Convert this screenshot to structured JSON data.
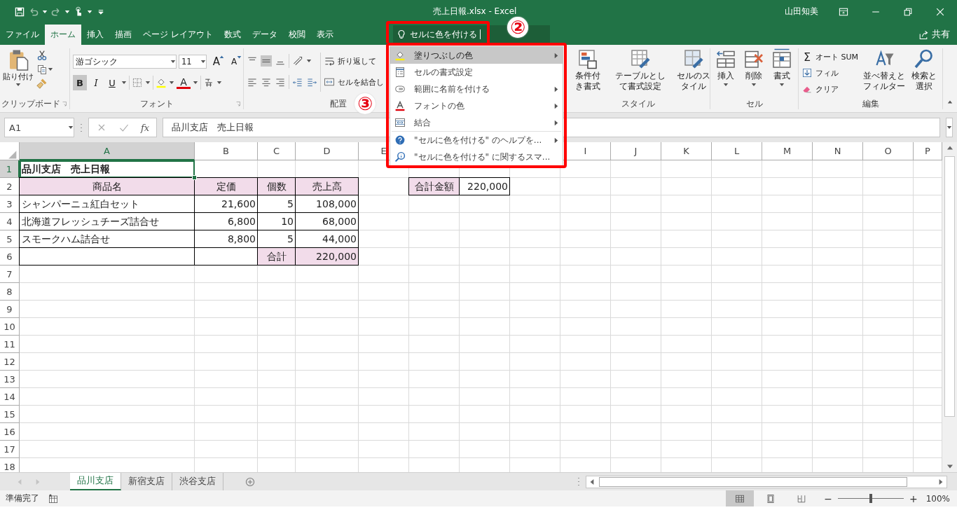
{
  "title_bar": {
    "title": "売上日報.xlsx - Excel",
    "user": "山田知美"
  },
  "tabs": [
    {
      "label": "ファイル",
      "selected": false
    },
    {
      "label": "ホーム",
      "selected": true
    },
    {
      "label": "挿入",
      "selected": false
    },
    {
      "label": "描画",
      "selected": false
    },
    {
      "label": "ページ レイアウト",
      "selected": false
    },
    {
      "label": "数式",
      "selected": false
    },
    {
      "label": "データ",
      "selected": false
    },
    {
      "label": "校閲",
      "selected": false
    },
    {
      "label": "表示",
      "selected": false
    }
  ],
  "search": {
    "value": "セルに色を付ける"
  },
  "share": "共有",
  "ribbon": {
    "clipboard": {
      "paste": "貼り付け",
      "label": "クリップボード"
    },
    "font": {
      "name": "游ゴシック",
      "size": "11",
      "grow": "A",
      "shrink": "A",
      "bold": "B",
      "italic": "I",
      "underline": "U",
      "color_letter": "A",
      "label": "フォント"
    },
    "alignment": {
      "wrap": "折り返して",
      "merge": "セルを結合し",
      "label": "配置"
    },
    "styles": {
      "buttons": [
        "条件付き書式",
        "テーブルとして書式設定",
        "セルのスタイル"
      ],
      "label": "スタイル"
    },
    "cells": {
      "buttons": [
        "挿入",
        "削除",
        "書式"
      ],
      "label": "セル"
    },
    "editing": {
      "sigma": "Σ",
      "autosum": "オート SUM",
      "fill": "フィル",
      "clear": "クリア",
      "sort": "並べ替えとフィルター",
      "find": "検索と選択",
      "label": "編集"
    }
  },
  "menu": [
    {
      "label": "塗りつぶしの色",
      "kind": "command",
      "submenu": true,
      "selected": true
    },
    {
      "label": "セルの書式設定",
      "kind": "command",
      "submenu": false,
      "selected": false
    },
    {
      "label": "範囲に名前を付ける",
      "kind": "command",
      "submenu": true,
      "selected": false
    },
    {
      "label": "フォントの色",
      "kind": "command",
      "submenu": true,
      "selected": false
    },
    {
      "label": "結合",
      "kind": "command",
      "submenu": true,
      "selected": false
    },
    {
      "label": "\"セルに色を付ける\" のヘルプを...",
      "kind": "help",
      "submenu": true,
      "selected": false
    },
    {
      "label": "\"セルに色を付ける\" に関するスマ...",
      "kind": "help",
      "submenu": false,
      "selected": false
    }
  ],
  "formula_bar": {
    "name_box": "A1",
    "function_label": "fx",
    "content": "品川支店　売上日報"
  },
  "sheet": {
    "columns": [
      {
        "label": "A",
        "selected": true
      },
      {
        "label": "B",
        "selected": false
      },
      {
        "label": "C",
        "selected": false
      },
      {
        "label": "D",
        "selected": false
      },
      {
        "label": "E",
        "selected": false
      },
      {},
      {},
      {},
      {
        "label": "I",
        "selected": false
      },
      {
        "label": "J",
        "selected": false
      },
      {
        "label": "K",
        "selected": false
      },
      {
        "label": "L",
        "selected": false
      },
      {
        "label": "M",
        "selected": false
      },
      {
        "label": "N",
        "selected": false
      },
      {
        "label": "O",
        "selected": false
      },
      {
        "label": "P",
        "selected": false
      }
    ],
    "rows": [
      {
        "num": "1",
        "selected": true,
        "cells": [
          {
            "text": "品川支店　売上日報",
            "kind": "title",
            "fill": false,
            "border": false
          }
        ]
      },
      {
        "num": "2",
        "selected": false,
        "cells": [
          {
            "text": "商品名",
            "kind": "heading",
            "fill": true,
            "border": true
          },
          {
            "text": "定価",
            "kind": "heading",
            "fill": true,
            "border": true
          },
          {
            "text": "個数",
            "kind": "heading",
            "fill": true,
            "border": true
          },
          {
            "text": "売上高",
            "kind": "heading",
            "fill": true,
            "border": true
          },
          {
            "fill": false,
            "border": false
          },
          {
            "text": "合計金額",
            "kind": "heading",
            "fill": true,
            "border": true
          },
          {
            "text": "220,000",
            "kind": "number",
            "fill": false,
            "border": true
          }
        ]
      },
      {
        "num": "3",
        "selected": false,
        "cells": [
          {
            "text": "シャンパーニュ紅白セット",
            "kind": "text",
            "fill": false,
            "border": true
          },
          {
            "text": "21,600",
            "kind": "number",
            "fill": false,
            "border": true
          },
          {
            "text": "5",
            "kind": "number",
            "fill": false,
            "border": true
          },
          {
            "text": "108,000",
            "kind": "number",
            "fill": false,
            "border": true
          }
        ]
      },
      {
        "num": "4",
        "selected": false,
        "cells": [
          {
            "text": "北海道フレッシュチーズ詰合せ",
            "kind": "text",
            "fill": false,
            "border": true
          },
          {
            "text": "6,800",
            "kind": "number",
            "fill": false,
            "border": true
          },
          {
            "text": "10",
            "kind": "number",
            "fill": false,
            "border": true
          },
          {
            "text": "68,000",
            "kind": "number",
            "fill": false,
            "border": true
          }
        ]
      },
      {
        "num": "5",
        "selected": false,
        "cells": [
          {
            "text": "スモークハム詰合せ",
            "kind": "text",
            "fill": false,
            "border": true
          },
          {
            "text": "8,800",
            "kind": "number",
            "fill": false,
            "border": true
          },
          {
            "text": "5",
            "kind": "number",
            "fill": false,
            "border": true
          },
          {
            "text": "44,000",
            "kind": "number",
            "fill": false,
            "border": true
          }
        ]
      },
      {
        "num": "6",
        "selected": false,
        "cells": [
          {
            "fill": false,
            "border": true
          },
          {
            "fill": false,
            "border": true
          },
          {
            "text": "合計",
            "kind": "heading",
            "fill": true,
            "border": true
          },
          {
            "text": "220,000",
            "kind": "number",
            "fill": true,
            "border": true
          }
        ]
      },
      {
        "num": "7",
        "selected": false
      },
      {
        "num": "8",
        "selected": false
      },
      {
        "num": "9",
        "selected": false
      },
      {
        "num": "10",
        "selected": false
      },
      {
        "num": "11",
        "selected": false
      },
      {
        "num": "12",
        "selected": false
      },
      {
        "num": "13",
        "selected": false
      },
      {
        "num": "14",
        "selected": false
      },
      {
        "num": "15",
        "selected": false
      },
      {
        "num": "16",
        "selected": false
      },
      {
        "num": "17",
        "selected": false
      },
      {
        "num": "18",
        "selected": false
      }
    ]
  },
  "sheet_tabs": [
    {
      "label": "品川支店",
      "selected": true
    },
    {
      "label": "新宿支店",
      "selected": false
    },
    {
      "label": "渋谷支店",
      "selected": false
    }
  ],
  "status_bar": {
    "text": "準備完了",
    "views": [
      {
        "selected": true
      },
      {
        "selected": false
      },
      {
        "selected": false
      }
    ],
    "zoom_out": "−",
    "zoom_in": "+",
    "zoom_slider": {
      "level": 0.5
    },
    "zoom": "100%"
  },
  "annotations": [
    {
      "label": "②"
    },
    {
      "label": "③"
    }
  ]
}
